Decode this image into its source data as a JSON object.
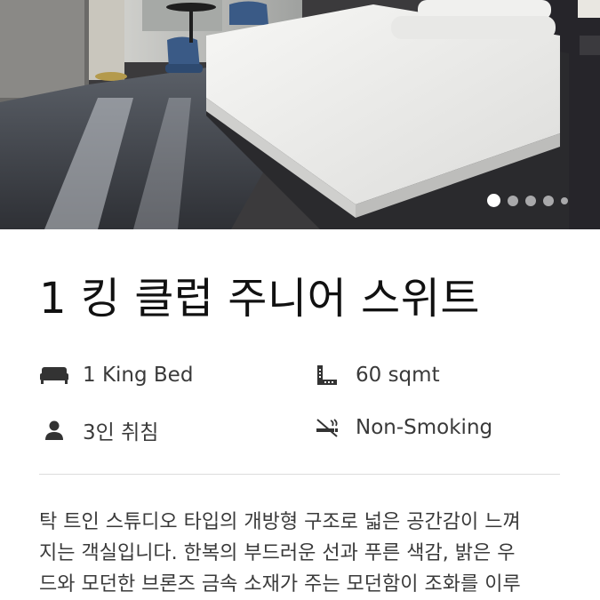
{
  "hero": {
    "image_alt": "hotel room with king bed",
    "carousel": {
      "total": 5,
      "active_index": 0
    }
  },
  "room": {
    "title": "1 킹 클럽 주니어 스위트",
    "features": [
      {
        "icon": "bed-icon",
        "text": "1 King Bed"
      },
      {
        "icon": "ruler-area-icon",
        "text": "60 sqmt"
      },
      {
        "icon": "person-icon",
        "text": "3인 취침"
      },
      {
        "icon": "no-smoking-icon",
        "text": "Non-Smoking"
      }
    ],
    "description_lines": [
      "탁 트인 스튜디오 타입의 개방형 구조로 넓은 공간감이 느껴",
      "지는 객실입니다. 한복의 부드러운 선과 푸른 색감, 밝은 우",
      "드와 모던한 브론즈 금속 소재가 주는 모던함이 조화를 이루"
    ]
  },
  "colors": {
    "text_primary": "#111111",
    "text_secondary": "#3a3a3a",
    "divider": "#dcdcdc"
  }
}
